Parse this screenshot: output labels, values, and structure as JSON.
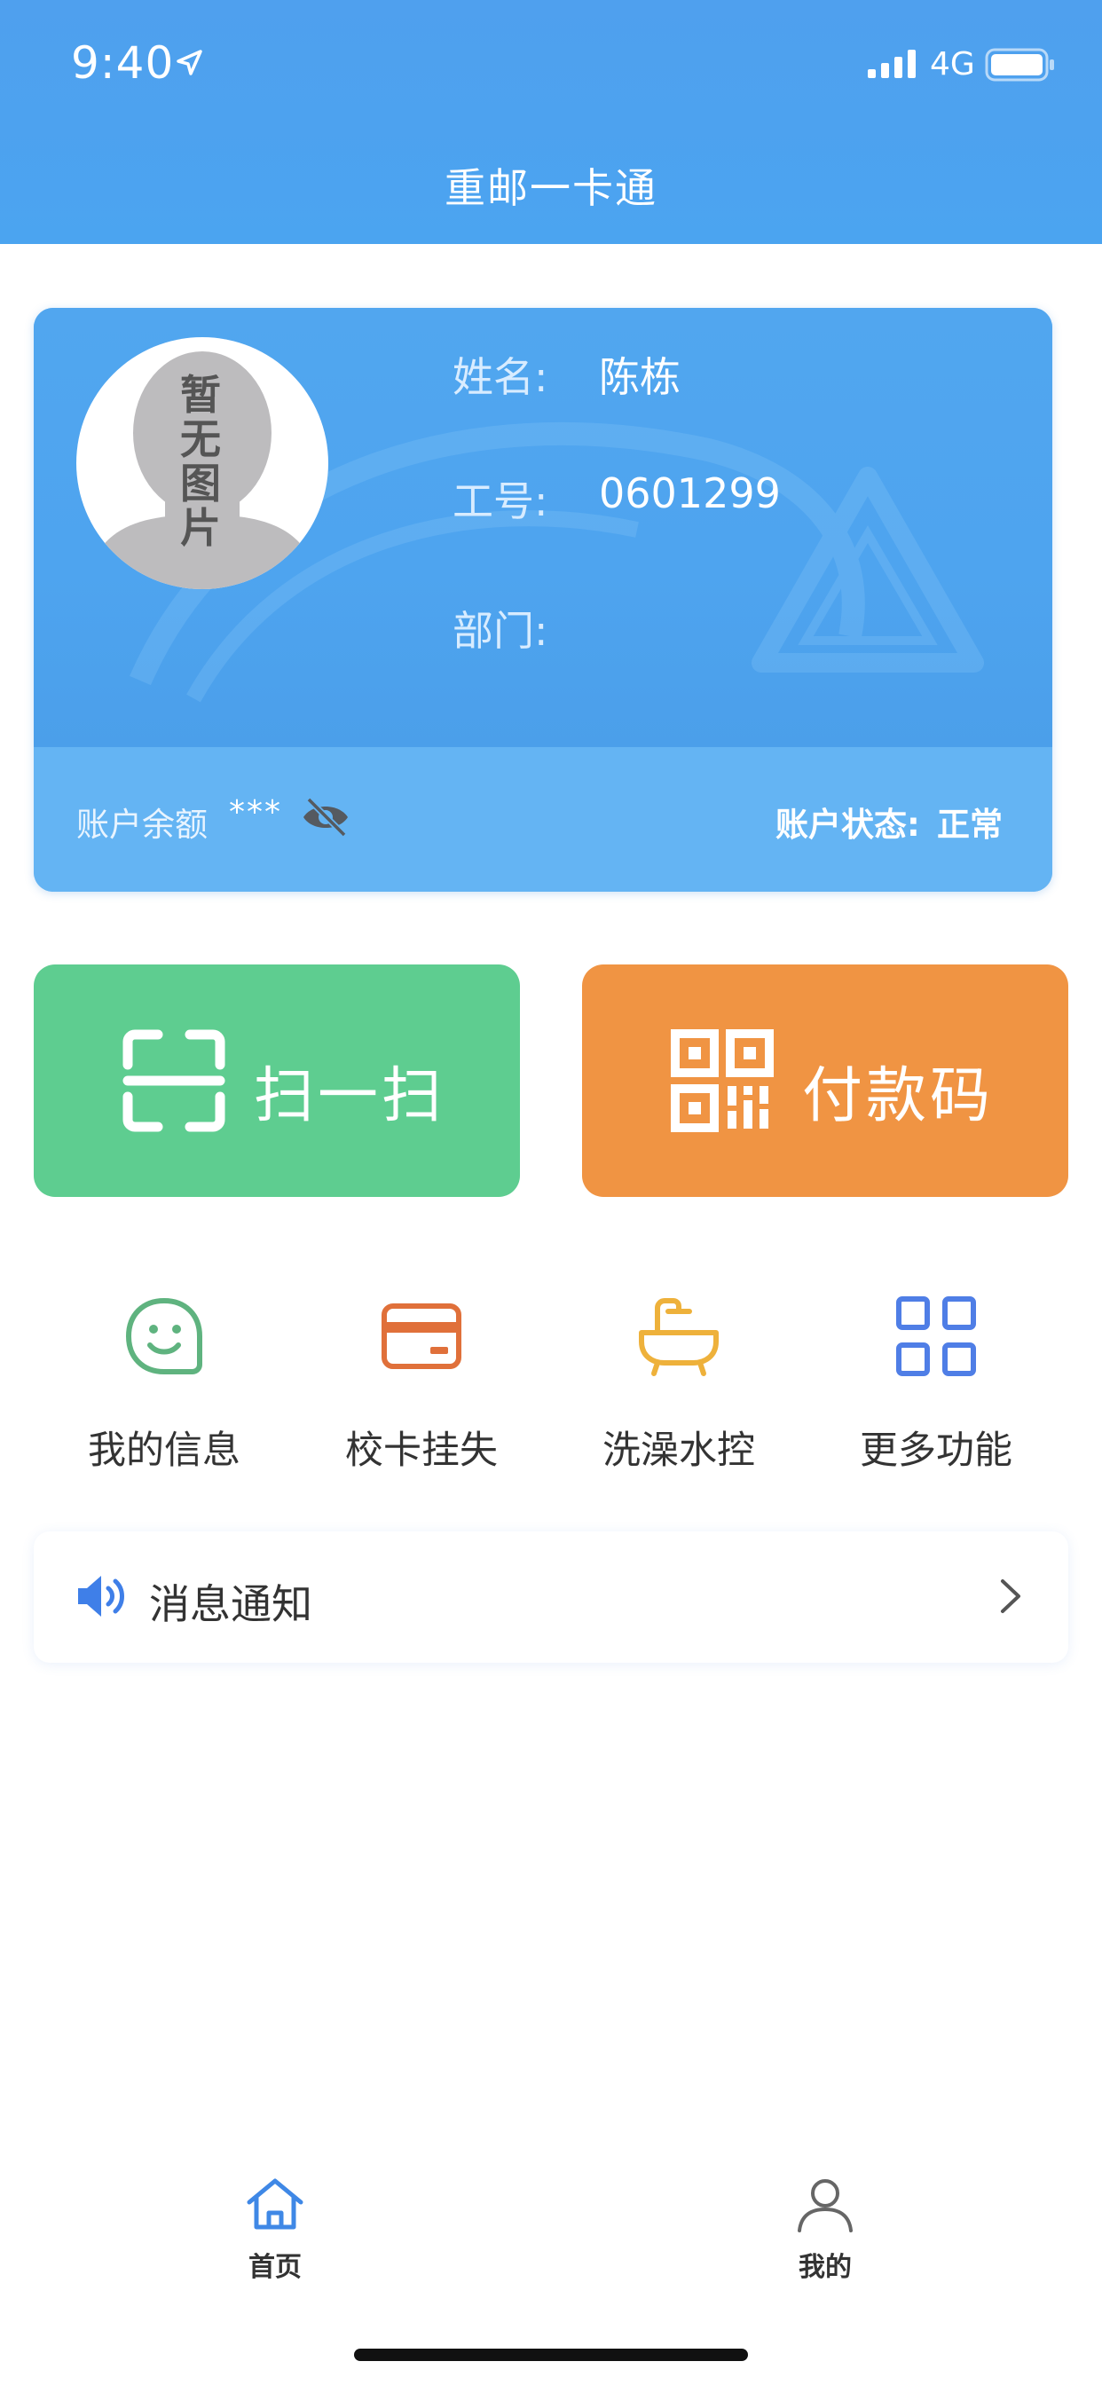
{
  "status_bar": {
    "time": "9:40",
    "network": "4G"
  },
  "header": {
    "title": "重邮一卡通"
  },
  "card": {
    "avatar_placeholder": "暂无图片",
    "name_label": "姓名:",
    "name_value": "陈栋",
    "id_label": "工号:",
    "id_value": "0601299",
    "dept_label": "部门:",
    "dept_value": "",
    "balance_label": "账户余额",
    "balance_value": "***",
    "status_label": "账户状态:",
    "status_value": "正常"
  },
  "actions": {
    "scan_label": "扫一扫",
    "pay_label": "付款码"
  },
  "menu": {
    "items": [
      {
        "label": "我的信息",
        "icon": "smiley-icon"
      },
      {
        "label": "校卡挂失",
        "icon": "card-icon"
      },
      {
        "label": "洗澡水控",
        "icon": "bathtub-icon"
      },
      {
        "label": "更多功能",
        "icon": "grid-icon"
      }
    ]
  },
  "notice": {
    "label": "消息通知"
  },
  "tabbar": {
    "items": [
      {
        "label": "首页",
        "icon": "home-icon",
        "active": true
      },
      {
        "label": "我的",
        "icon": "user-icon",
        "active": false
      }
    ]
  },
  "colors": {
    "header": "#4fa0ee",
    "scan_button": "#5ecd90",
    "pay_button": "#f09443",
    "smiley": "#5fb37f",
    "card_icon": "#e0703a",
    "bathtub": "#eeb13b",
    "grid_icon": "#4f7ee6",
    "speaker": "#3f7fe8"
  }
}
